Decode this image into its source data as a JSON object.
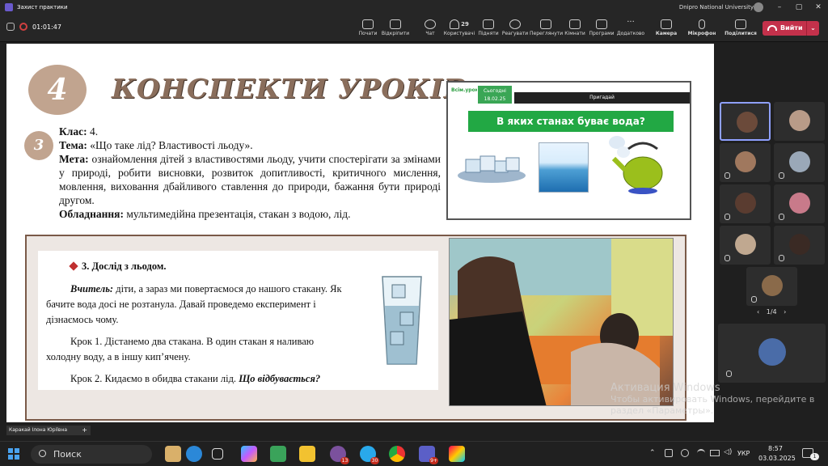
{
  "titlebar": {
    "title": "Захист практики",
    "org": "Dnipro National University",
    "minimize": "–",
    "maximize": "▢",
    "close": "✕"
  },
  "meeting": {
    "timer": "01:01:47"
  },
  "toolbar": {
    "buttons": [
      {
        "label": "Почати",
        "icon": "share-tray-icon"
      },
      {
        "label": "Відкріпити",
        "icon": "unpin-icon"
      },
      {
        "label": "Чат",
        "icon": "chat-icon"
      },
      {
        "label": "Користувачі",
        "icon": "people-icon",
        "count": "29"
      },
      {
        "label": "Підняти",
        "icon": "raise-hand-icon"
      },
      {
        "label": "Реагувати",
        "icon": "react-icon"
      },
      {
        "label": "Переглянути",
        "icon": "view-icon"
      },
      {
        "label": "Кімнати",
        "icon": "rooms-icon"
      },
      {
        "label": "Програми",
        "icon": "apps-icon"
      },
      {
        "label": "Додатково",
        "icon": "more-icon"
      },
      {
        "label": "Камера",
        "icon": "camera-off-icon"
      },
      {
        "label": "Мікрофон",
        "icon": "mic-off-icon"
      },
      {
        "label": "Поділитися",
        "icon": "share-icon"
      }
    ],
    "leave": "Вийти"
  },
  "slide": {
    "number": "4",
    "heading": "КОНСПЕКТИ УРОКІВ",
    "sub_number": "3",
    "lesson": {
      "class_label": "Клас:",
      "class_value": " 4.",
      "topic_label": "Тема:",
      "topic_value": " «Що таке лід? Властивості льоду».",
      "goal_label": "Мета:",
      "goal_value": " ознайомлення дітей з властивостями льоду, учити спостерігати за змінами у природі, робити висновки, розвиток допитливості, критичного мислення, мовлення, виховання дбайливого ставлення до природи, бажання бути природі другом.",
      "equip_label": "Обладнання:",
      "equip_value": " мультимедійна презентація, стакан з водою, лід."
    },
    "thumb": {
      "logo": "Всім.урок",
      "date_label": "Сьогодні",
      "date": "18.02.25",
      "bar": "Пригадай",
      "question": "В яких станах буває вода?"
    },
    "experiment": {
      "title": "3. Дослід з льодом.",
      "teacher_label": "Вчитель:",
      "teacher_text": " діти, а зараз ми повертаємося до нашого стакану. Як бачите вода досі не розтанула. Давай проведемо експеримент і дізнаємось чому.",
      "step1": "Крок 1. Дістанемо два стакана. В один стакан я наливаю холодну воду, а в іншу кип’ячену.",
      "step2_text": "Крок 2. Кидаємо в обидва стакани лід. ",
      "step2_em": "Що відбувається?"
    }
  },
  "watermark": {
    "title": "Активация Windows",
    "text": "Чтобы активировать Windows, перейдите в раздел «Параметры»."
  },
  "presenter": {
    "name": "Каракай Ілона Юріївна",
    "plus": "+"
  },
  "gallery": {
    "pager": "1/4",
    "prev": "‹",
    "next": "›"
  },
  "taskbar": {
    "search": "Поиск",
    "badges": {
      "viber": "13",
      "telegram": "30",
      "teams": "9+"
    },
    "lang": "УКР",
    "time": "8:57",
    "date": "03.03.2025",
    "notifications": "1"
  },
  "colors": {
    "accent_brown": "#c1a48f",
    "leave_red": "#c4314b",
    "slide_green": "#22a844"
  }
}
